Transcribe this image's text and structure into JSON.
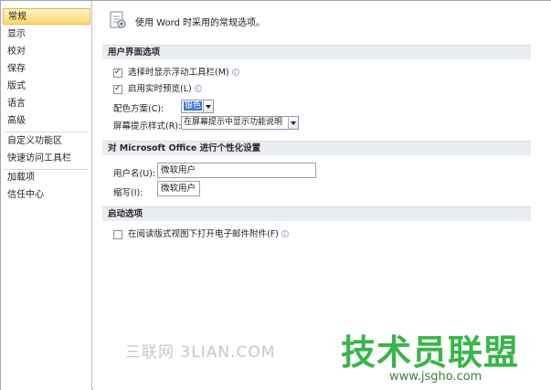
{
  "sidebar": {
    "items": [
      {
        "label": "常规"
      },
      {
        "label": "显示"
      },
      {
        "label": "校对"
      },
      {
        "label": "保存"
      },
      {
        "label": "版式"
      },
      {
        "label": "语言"
      },
      {
        "label": "高级"
      },
      {
        "label": "自定义功能区"
      },
      {
        "label": "快速访问工具栏"
      },
      {
        "label": "加载项"
      },
      {
        "label": "信任中心"
      }
    ],
    "active_index": 0
  },
  "main": {
    "header_icon": "general-options-icon",
    "header_title": "使用 Word 时采用的常规选项。",
    "sections": {
      "ui_options": {
        "title": "用户界面选项",
        "mini_toolbar": {
          "label": "选择时显示浮动工具栏(M)",
          "checked": true
        },
        "live_preview": {
          "label": "启用实时预览(L)",
          "checked": true
        },
        "color_scheme": {
          "label": "配色方案(C):",
          "value": "银色"
        },
        "screentip_style": {
          "label": "屏幕提示样式(R):",
          "value": "在屏幕提示中显示功能说明"
        }
      },
      "personalize": {
        "title": "对 Microsoft Office 进行个性化设置",
        "username": {
          "label": "用户名(U):",
          "value": "微软用户"
        },
        "initials": {
          "label": "缩写(I):",
          "value": "微软用户"
        }
      },
      "startup": {
        "title": "启动选项",
        "open_reading": {
          "label": "在阅读版式视图下打开电子邮件附件(F)",
          "checked": false
        }
      }
    },
    "info_glyph": "i"
  },
  "watermarks": {
    "left": "三联网 3LIAN.COM",
    "right_big": "技术员联盟",
    "right_small": "www.jsgho.com"
  },
  "colors": {
    "active_nav": "#ffd96b",
    "section_bg": "#e9ecf1",
    "selection": "#3875d7",
    "watermark_green": "#39b54a"
  }
}
